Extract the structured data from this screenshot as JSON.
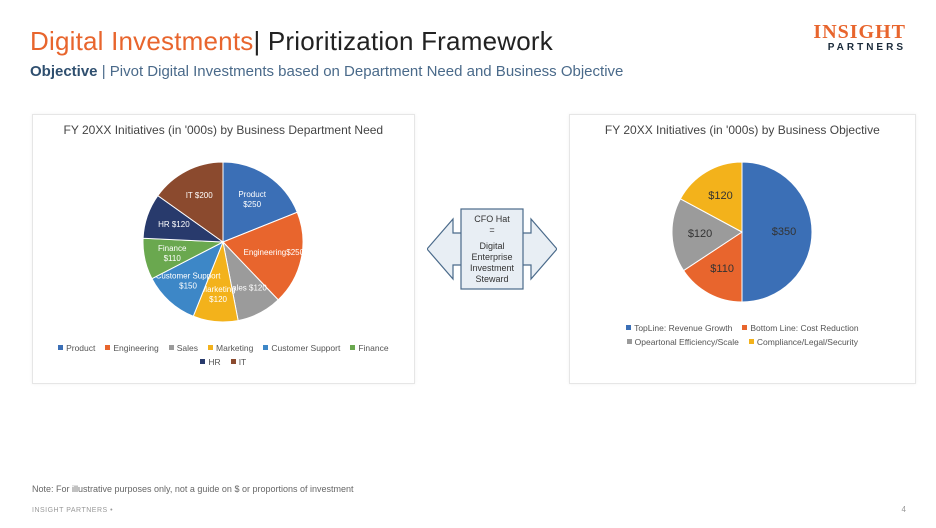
{
  "header": {
    "title_highlight": "Digital Investments",
    "title_rest": "| Prioritization Framework",
    "subtitle_label": "Objective",
    "subtitle_text": " | Pivot Digital Investments based on Department Need and Business Objective"
  },
  "logo": {
    "top": "INSIGHT",
    "bottom": "PARTNERS"
  },
  "center_box": {
    "line1": "CFO Hat",
    "line2": "=",
    "line3": "Digital",
    "line4": "Enterprise",
    "line5": "Investment",
    "line6": "Steward"
  },
  "note": "Note: For illustrative purposes only, not a guide on $ or proportions of investment",
  "footer_left": "INSIGHT PARTNERS      •",
  "footer_right": "4",
  "chart_data": [
    {
      "type": "pie",
      "title": "FY 20XX Initiatives (in '000s) by Business Department Need",
      "series": [
        {
          "name": "Product",
          "value": 250,
          "label": "Product $250",
          "color": "#3B6FB6"
        },
        {
          "name": "Engineering",
          "value": 250,
          "label": "Engineering$250",
          "color": "#E8652D"
        },
        {
          "name": "Sales",
          "value": 120,
          "label": "Sales $120",
          "color": "#9B9B9B"
        },
        {
          "name": "Marketing",
          "value": 120,
          "label": "Marketing $120",
          "color": "#F3B21B"
        },
        {
          "name": "Customer Support",
          "value": 150,
          "label": "Customer Support $150",
          "color": "#3D87C7"
        },
        {
          "name": "Finance",
          "value": 110,
          "label": "Finance $110",
          "color": "#6AA84F"
        },
        {
          "name": "HR",
          "value": 120,
          "label": "HR $120",
          "color": "#283A6C"
        },
        {
          "name": "IT",
          "value": 200,
          "label": "IT $200",
          "color": "#8B4A2E"
        }
      ],
      "legend": [
        "Product",
        "Engineering",
        "Sales",
        "Marketing",
        "Customer Support",
        "Finance",
        "HR",
        "IT"
      ]
    },
    {
      "type": "pie",
      "title": "FY 20XX Initiatives (in '000s) by Business Objective",
      "series": [
        {
          "name": "TopLine: Revenue Growth",
          "value": 350,
          "label": "$350",
          "color": "#3B6FB6"
        },
        {
          "name": "Bottom Line: Cost Reduction",
          "value": 110,
          "label": "$110",
          "color": "#E8652D"
        },
        {
          "name": "Opeartonal Efficiency/Scale",
          "value": 120,
          "label": "$120",
          "color": "#9B9B9B"
        },
        {
          "name": "Compliance/Legal/Security",
          "value": 120,
          "label": "$120",
          "color": "#F3B21B"
        }
      ],
      "legend": [
        "TopLine: Revenue Growth",
        "Bottom Line: Cost Reduction",
        "Opeartonal Efficiency/Scale",
        "Compliance/Legal/Security"
      ]
    }
  ]
}
